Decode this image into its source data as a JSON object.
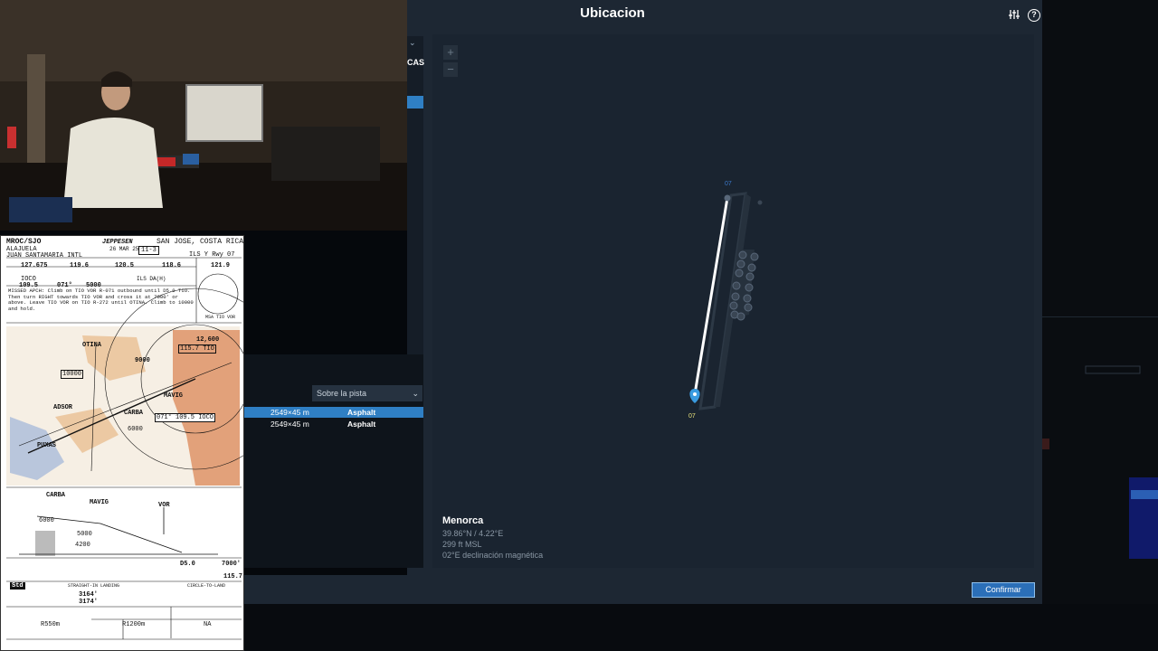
{
  "dialog": {
    "title": "Ubicacion",
    "settings_icon": "sliders-icon",
    "help_icon": "help-icon",
    "left_tab_label": "CAS"
  },
  "map": {
    "zoom_in": "+",
    "zoom_out": "−",
    "runway_end_top": "07",
    "runway_end_bottom": "07",
    "location": {
      "name": "Menorca",
      "coords": "39.86°N / 4.22°E",
      "elevation": "299 ft MSL",
      "declination": "02°E declinación magnética"
    }
  },
  "runways": {
    "filter_select": "Sobre la pista",
    "rows": [
      {
        "dimensions": "2549×45 m",
        "surface": "Asphalt",
        "selected": true
      },
      {
        "dimensions": "2549×45 m",
        "surface": "Asphalt",
        "selected": false
      }
    ]
  },
  "footer": {
    "confirm_label": "Confirmar"
  },
  "chart": {
    "airport_id": "MROC/SJO",
    "city": "SAN JOSE, COSTA RICA",
    "alajuela": "ALAJUELA",
    "airport_name": "JUAN SANTAMARIA INTL",
    "brand": "JEPPESEN",
    "date": "26 MAR 25",
    "page": "11-3",
    "procedure": "ILS Y Rwy 07",
    "freqs": [
      "127.675",
      "119.6",
      "120.5",
      "118.6",
      "121.9"
    ],
    "loc": "109.5",
    "loc_id": "IOCO",
    "course": "071°",
    "mavig": "5000",
    "ils_dh": "ILS DA(H)",
    "missed": "MISSED APCH: Climb on TIO VOR R-071 outbound until D5.0 TIO. Then turn RIGHT towards TIO VOR and cross it at 7000' or above. Leave TIO VOR on TIO R-272 until OTINA. Climb to 10000 and hold.",
    "fixes": [
      "OTINA",
      "MAVIG",
      "CARBA",
      "ADSOR",
      "PUXAS",
      "VOR",
      "TIO"
    ],
    "msa": "MSA TIO VOR",
    "alt_12600": "12,600",
    "alt_9000": "9000",
    "alt_10000": "10000",
    "alt_6000": "6000",
    "final_course_box": "071° 109.5 IOCO",
    "tio_freq": "115.7 TIO",
    "profile_alts": [
      "6000",
      "5000",
      "4200"
    ],
    "minima_da": "3164'",
    "minima_da2": "3174'",
    "rvr1": "R550m",
    "rvr2": "R1200m",
    "circle": "NA",
    "d50": "D5.0",
    "alt7000": "7000'",
    "vor_freq": "115.7",
    "std_label": "Std",
    "straight_in": "STRAIGHT-IN LANDING",
    "circle_to_land": "CIRCLE-TO-LAND"
  },
  "colors": {
    "accent": "#2f7fc4",
    "dialog_bg": "#1d2733",
    "map_bg": "#1a2430",
    "runway": "#ffffff",
    "marker": "#3a9be0"
  }
}
